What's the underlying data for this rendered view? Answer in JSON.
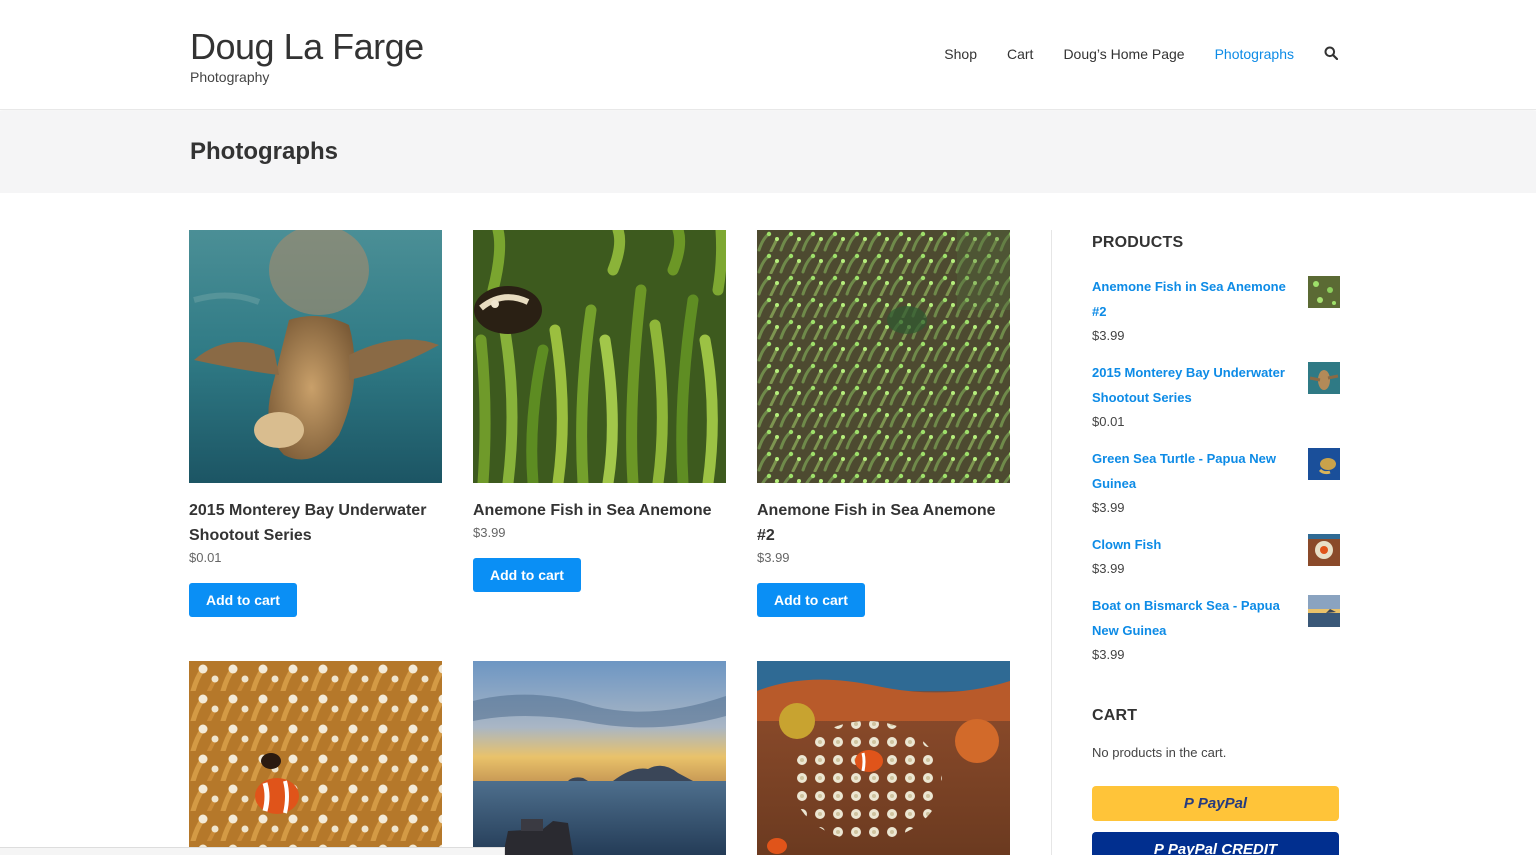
{
  "site": {
    "title": "Doug La Farge",
    "tagline": "Photography"
  },
  "nav": {
    "items": [
      "Shop",
      "Cart",
      "Doug’s Home Page",
      "Photographs"
    ],
    "active": "Photographs"
  },
  "page": {
    "title": "Photographs"
  },
  "products": [
    {
      "name": "2015 Monterey Bay Underwater Shootout Series",
      "price": "$0.01",
      "button": "Add to cart"
    },
    {
      "name": "Anemone Fish in Sea Anemone",
      "price": "$3.99",
      "button": "Add to cart"
    },
    {
      "name": "Anemone Fish in Sea Anemone #2",
      "price": "$3.99",
      "button": "Add to cart"
    }
  ],
  "sidebar": {
    "products_title": "PRODUCTS",
    "products": [
      {
        "name": "Anemone Fish in Sea Anemone #2",
        "price": "$3.99"
      },
      {
        "name": "2015 Monterey Bay Underwater Shootout Series",
        "price": "$0.01"
      },
      {
        "name": "Green Sea Turtle - Papua New Guinea",
        "price": "$3.99"
      },
      {
        "name": "Clown Fish",
        "price": "$3.99"
      },
      {
        "name": "Boat on Bismarck Sea - Papua New Guinea",
        "price": "$3.99"
      }
    ],
    "cart_title": "CART",
    "cart_empty": "No products in the cart.",
    "paypal_label": "PayPal",
    "paypal_credit_label": "PayPal CREDIT"
  },
  "colors": {
    "accent": "#0d8be6",
    "button": "#0a8ff5",
    "paypal_yellow": "#ffc439",
    "paypal_blue": "#012f8f"
  }
}
